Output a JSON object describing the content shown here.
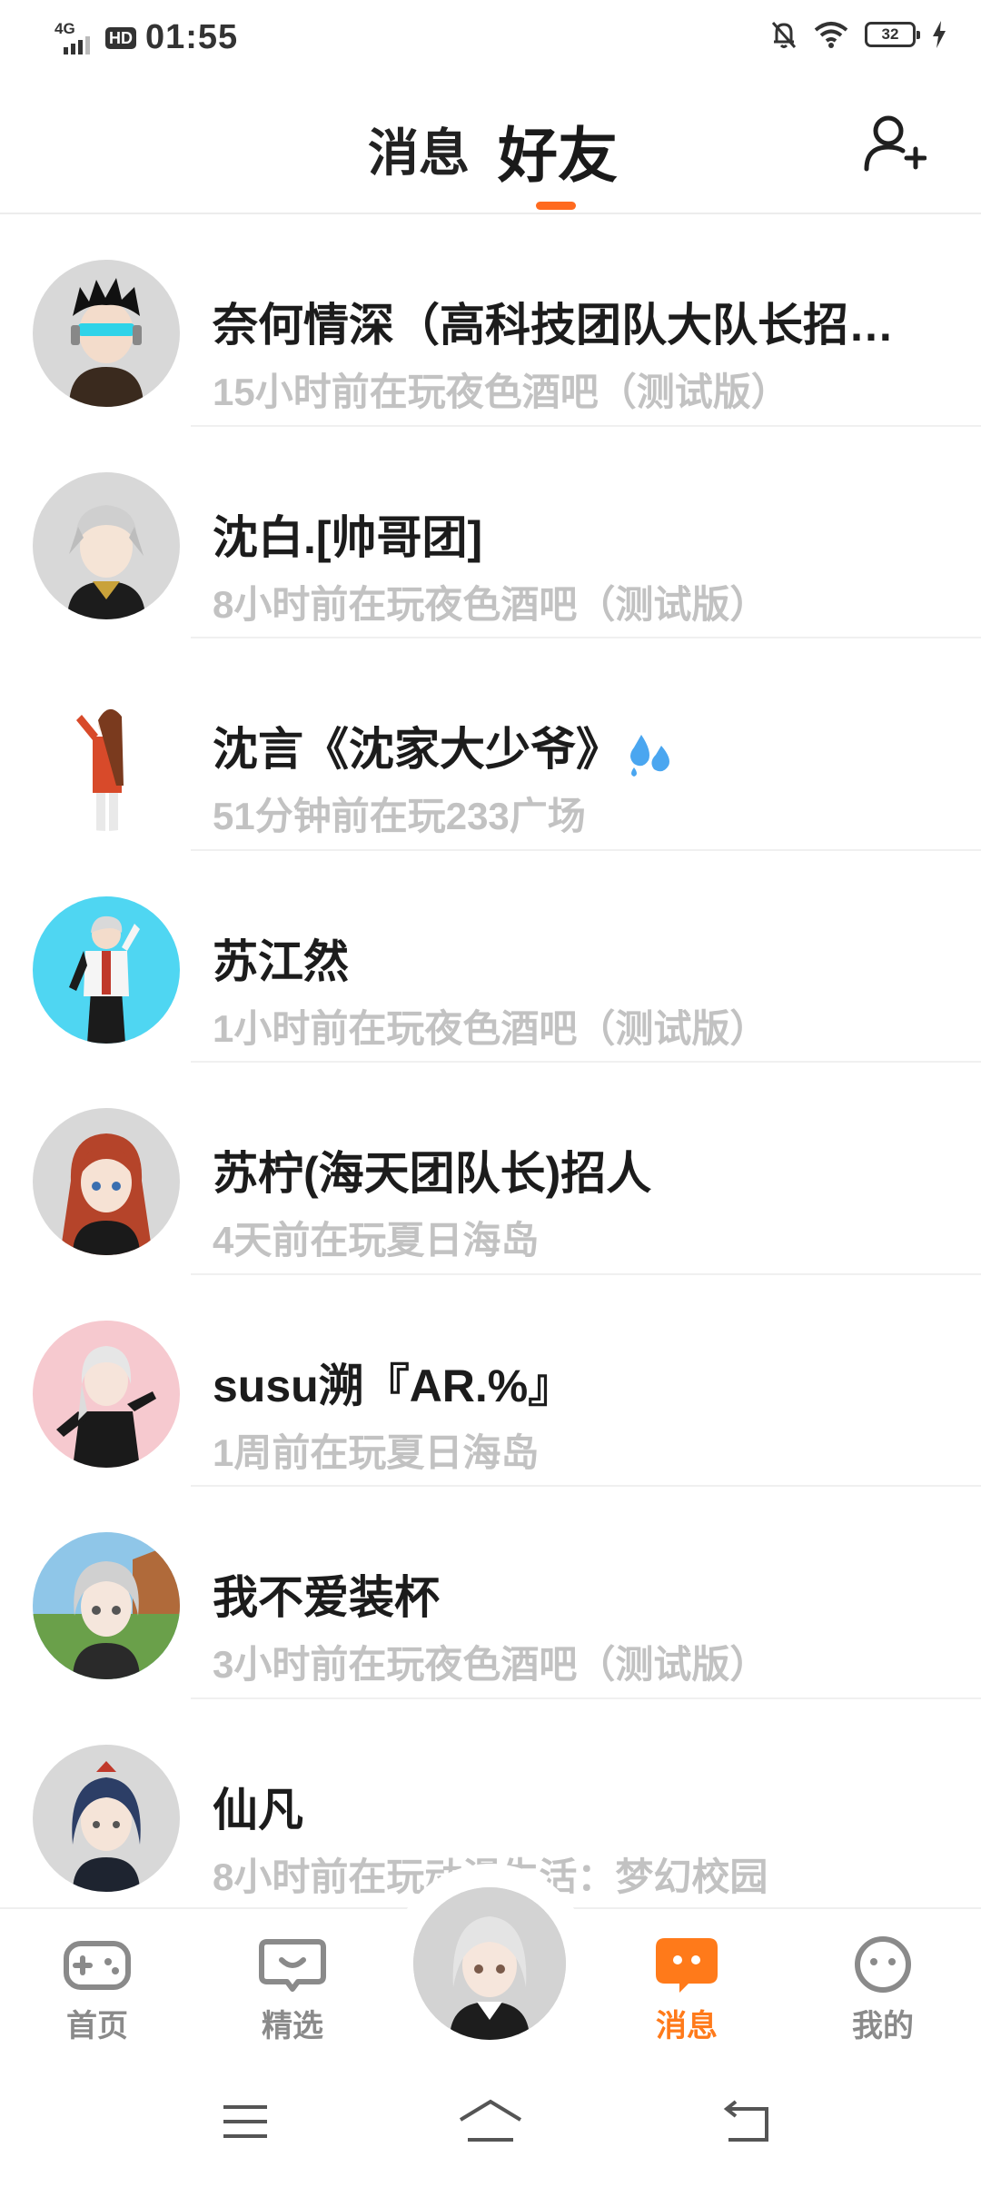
{
  "status_bar": {
    "network": "4G",
    "hd": "HD",
    "time": "01:55",
    "battery": "32"
  },
  "header": {
    "tab_messages": "消息",
    "tab_friends": "好友",
    "add_friend_icon": "add-person-icon"
  },
  "friends": [
    {
      "name": "奈何情深（高科技团队大队长招…",
      "status": "15小时前在玩夜色酒吧（测试版）"
    },
    {
      "name": "沈白.[帅哥团]",
      "status": "8小时前在玩夜色酒吧（测试版）"
    },
    {
      "name": "沈言《沈家大少爷》",
      "status": "51分钟前在玩233广场"
    },
    {
      "name": "苏江然",
      "status": "1小时前在玩夜色酒吧（测试版）"
    },
    {
      "name": "苏柠(海天团队长)招人",
      "status": "4天前在玩夏日海岛"
    },
    {
      "name": "susu溯『AR.%』",
      "status": "1周前在玩夏日海岛"
    },
    {
      "name": "我不爱装杯",
      "status": "3小时前在玩夜色酒吧（测试版）"
    },
    {
      "name": "仙凡",
      "status": "8小时前在玩动漫生活：梦幻校园"
    }
  ],
  "bottom_nav": [
    {
      "label": "首页",
      "icon": "gamepad-icon"
    },
    {
      "label": "精选",
      "icon": "heart-chat-icon"
    },
    {
      "label": "消息",
      "icon": "message-bubble-icon",
      "active": true
    },
    {
      "label": "我的",
      "icon": "smiley-face-icon"
    }
  ],
  "colors": {
    "accent": "#ff6a1f",
    "inactive_text": "#8a8a8a",
    "status_text": "#c2c2c2"
  }
}
